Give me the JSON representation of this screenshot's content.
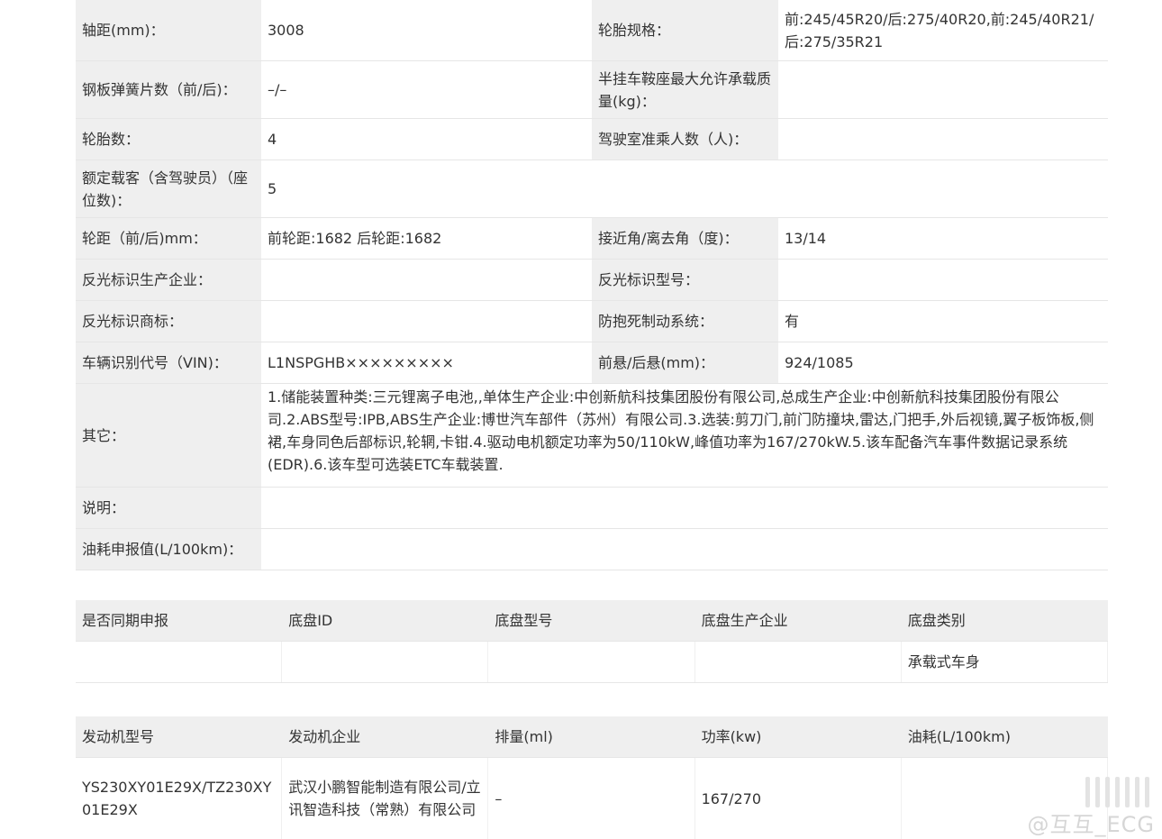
{
  "spec_table": {
    "rows": [
      {
        "l1": "轴距(mm)：",
        "v1": "3008",
        "l2": "轮胎规格：",
        "v2": "前:245/45R20/后:275/40R20,前:245/40R21/后:275/35R21"
      },
      {
        "l1": "钢板弹簧片数（前/后)：",
        "v1": "–/–",
        "l2": "半挂车鞍座最大允许承载质量(kg)：",
        "v2": ""
      },
      {
        "l1": "轮胎数：",
        "v1": "4",
        "l2": "驾驶室准乘人数（人)：",
        "v2": ""
      },
      {
        "l1": "额定载客（含驾驶员）（座位数)：",
        "v1": "5"
      },
      {
        "l1": "轮距（前/后)mm：",
        "v1": "前轮距:1682 后轮距:1682",
        "l2": "接近角/离去角（度)：",
        "v2": "13/14"
      },
      {
        "l1": "反光标识生产企业：",
        "v1": "",
        "l2": "反光标识型号：",
        "v2": ""
      },
      {
        "l1": "反光标识商标：",
        "v1": "",
        "l2": "防抱死制动系统：",
        "v2": "有"
      },
      {
        "l1": "车辆识别代号（VIN)：",
        "v1": "L1NSPGHB×××××××××",
        "l2": "前悬/后悬(mm)：",
        "v2": "924/1085"
      },
      {
        "l1": "其它：",
        "v1": "1.储能装置种类:三元锂离子电池,,单体生产企业:中创新航科技集团股份有限公司,总成生产企业:中创新航科技集团股份有限公司.2.ABS型号:IPB,ABS生产企业:博世汽车部件（苏州）有限公司.3.选装:剪刀门,前门防撞块,雷达,门把手,外后视镜,翼子板饰板,侧裙,车身同色后部标识,轮辋,卡钳.4.驱动电机额定功率为50/110kW,峰值功率为167/270kW.5.该车配备汽车事件数据记录系统(EDR).6.该车型可选装ETC车载装置."
      },
      {
        "l1": "说明：",
        "v1": ""
      },
      {
        "l1": "油耗申报值(L/100km)：",
        "v1": ""
      }
    ]
  },
  "chassis_table": {
    "headers": [
      "是否同期申报",
      "底盘ID",
      "底盘型号",
      "底盘生产企业",
      "底盘类别"
    ],
    "row": [
      "",
      "",
      "",
      "",
      "承载式车身"
    ]
  },
  "engine_table": {
    "headers": [
      "发动机型号",
      "发动机企业",
      "排量(ml)",
      "功率(kw)",
      "油耗(L/100km)"
    ],
    "row": [
      "YS230XY01E29X/TZ230XY01E29X",
      "武汉小鹏智能制造有限公司/立讯智造科技（常熟）有限公司",
      "–",
      "167/270",
      ""
    ]
  },
  "watermark": "@互互_ECG"
}
